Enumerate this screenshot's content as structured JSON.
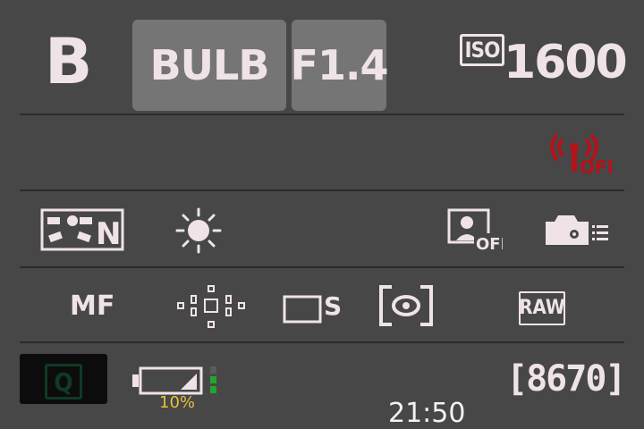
{
  "shooting_mode": "B",
  "shutter_speed": "BULB",
  "aperture": "F1.4",
  "iso": {
    "badge": "ISO",
    "value": "1600"
  },
  "wireless": {
    "status": "OFF"
  },
  "row2": {
    "picture_style": "N",
    "face_detect": "OFF"
  },
  "row3": {
    "focus_mode": "MF",
    "drive_mode_suffix": "S",
    "image_quality": "RAW"
  },
  "bottom": {
    "q_button": "Q",
    "battery_percent": "10%",
    "battery_level": 0.1,
    "shots_remaining": "[8670]",
    "time": "21:50"
  },
  "colors": {
    "background": "#474747",
    "highlight": "#757575",
    "text": "#efe3e8",
    "warning": "#b5121b",
    "battery_text": "#e7c13a",
    "battery_ok": "#1fa82a"
  },
  "icons": {
    "wireless": "wireless-off-icon",
    "picture_style": "picture-style-icon",
    "white_balance": "daylight-icon",
    "face_detect": "face-detect-off-icon",
    "camera_menu": "camera-menu-icon",
    "af_area": "af-points-icon",
    "drive": "drive-single-icon",
    "metering": "metering-icon",
    "battery": "battery-icon"
  }
}
